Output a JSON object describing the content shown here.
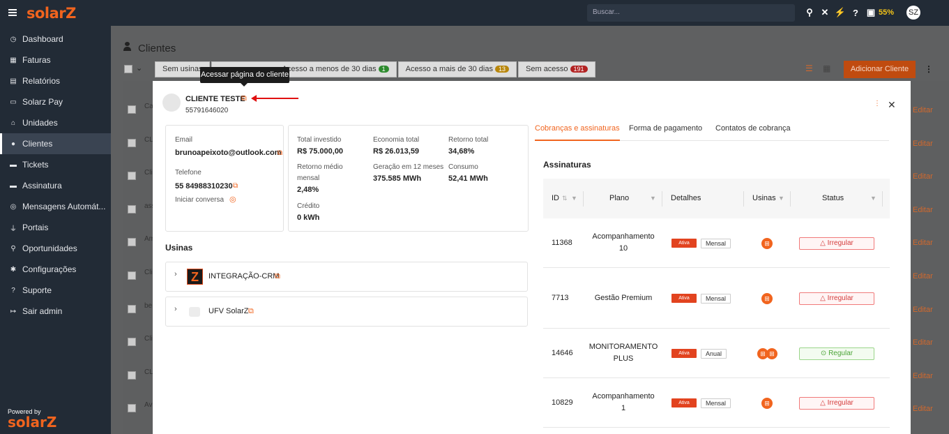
{
  "topbar": {
    "logo": "solarZ",
    "search_placeholder": "Buscar...",
    "battery_percent": "55%",
    "avatar": "SZ"
  },
  "sidebar": {
    "items": [
      {
        "label": "Dashboard",
        "icon": "dashboard-icon",
        "glyph": "◷"
      },
      {
        "label": "Faturas",
        "icon": "invoices-icon",
        "glyph": "▦"
      },
      {
        "label": "Relatórios",
        "icon": "reports-icon",
        "glyph": "▤"
      },
      {
        "label": "Solarz Pay",
        "icon": "card-icon",
        "glyph": "▭"
      },
      {
        "label": "Unidades",
        "icon": "home-icon",
        "glyph": "⌂"
      },
      {
        "label": "Clientes",
        "icon": "user-icon",
        "glyph": "●"
      },
      {
        "label": "Tickets",
        "icon": "ticket-icon",
        "glyph": "▬"
      },
      {
        "label": "Assinatura",
        "icon": "subscription-icon",
        "glyph": "▬"
      },
      {
        "label": "Mensagens Automát...",
        "icon": "whatsapp-icon",
        "glyph": "◎"
      },
      {
        "label": "Portais",
        "icon": "plug-icon",
        "glyph": "⏚"
      },
      {
        "label": "Oportunidades",
        "icon": "magnifier-icon",
        "glyph": "⚲"
      },
      {
        "label": "Configurações",
        "icon": "gear-icon",
        "glyph": "✱"
      },
      {
        "label": "Suporte",
        "icon": "question-icon",
        "glyph": "?"
      },
      {
        "label": "Sair admin",
        "icon": "logout-icon",
        "glyph": "↦"
      }
    ],
    "active": "Clientes",
    "powered_by": "Powered by",
    "powered_logo": "solarZ"
  },
  "background": {
    "title": "Clientes",
    "tabs": [
      {
        "label": "Sem usinas",
        "count": "",
        "color": "#2f80ed"
      },
      {
        "label": "Acesso a menos de 30 dias",
        "count": "1",
        "color": "#2e8b2e"
      },
      {
        "label": "Acesso a mais de 30 dias",
        "count": "13",
        "color": "#b8860b"
      },
      {
        "label": "Sem acesso",
        "count": "191",
        "color": "#b22222"
      }
    ],
    "add_button": "Adicionar Cliente",
    "rows": [
      "Ca",
      "CL",
      "Cli",
      "ass",
      "Am",
      "Cli",
      "be",
      "Cli",
      "CL",
      "Av"
    ],
    "edit_label": "Editar"
  },
  "tooltip": "Acessar página do cliente",
  "modal": {
    "client_name": "CLIENTE TESTE",
    "client_phone": "55791646020",
    "contact": {
      "email_label": "Email",
      "email": "brunoapeixoto@outlook.com",
      "phone_label": "Telefone",
      "phone": "55 84988310230",
      "chat_label": "Iniciar conversa"
    },
    "stats": {
      "total_investido_label": "Total investido",
      "total_investido": "R$ 75.000,00",
      "economia_label": "Economia total",
      "economia": "R$ 26.013,59",
      "retorno_label": "Retorno total",
      "retorno": "34,68%",
      "retorno_medio_label_1": "Retorno médio",
      "retorno_medio_label_2": "mensal",
      "retorno_medio": "2,48%",
      "geracao_label": "Geração em 12 meses",
      "geracao": "375.585 MWh",
      "consumo_label": "Consumo",
      "consumo": "52,41 MWh",
      "credito_label": "Crédito",
      "credito": "0 kWh"
    },
    "usinas_title": "Usinas",
    "usinas": [
      {
        "name": "INTEGRAÇÃO-CRM"
      },
      {
        "name": "UFV SolarZ"
      }
    ],
    "tabs": [
      "Cobranças e assinaturas",
      "Forma de pagamento",
      "Contatos de cobrança"
    ],
    "assinaturas_title": "Assinaturas",
    "table_headers": {
      "id": "ID",
      "plano": "Plano",
      "detalhes": "Detalhes",
      "usinas": "Usinas",
      "status": "Status"
    },
    "rows": [
      {
        "id": "11368",
        "plano1": "Acompanhamento",
        "plano2": "10",
        "ativa": "Ativa",
        "periodo": "Mensal",
        "status": "Irregular"
      },
      {
        "id": "7713",
        "plano1": "Gestão Premium",
        "plano2": "",
        "ativa": "Ativa",
        "periodo": "Mensal",
        "status": "Irregular"
      },
      {
        "id": "14646",
        "plano1": "MONITORAMENTO",
        "plano2": "PLUS",
        "ativa": "Ativa",
        "periodo": "Anual",
        "status": "Regular"
      },
      {
        "id": "10829",
        "plano1": "Acompanhamento",
        "plano2": "1",
        "ativa": "Ativa",
        "periodo": "Mensal",
        "status": "Irregular"
      }
    ]
  }
}
